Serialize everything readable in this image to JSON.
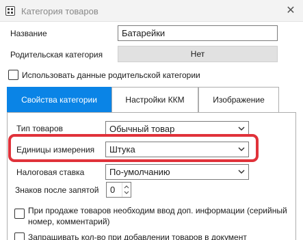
{
  "window": {
    "title": "Категория товаров",
    "close_glyph": "✕"
  },
  "form": {
    "name_label": "Название",
    "name_value": "Батарейки",
    "parent_label": "Родительская категория",
    "parent_value": "Нет",
    "use_parent_label": "Использовать данные родительской категории",
    "use_parent_checked": false
  },
  "tabs": [
    {
      "label": "Свойства категории",
      "active": true
    },
    {
      "label": "Настройки ККМ",
      "active": false
    },
    {
      "label": "Изображение",
      "active": false
    }
  ],
  "properties": {
    "goods_type_label": "Тип товаров",
    "goods_type_value": "Обычный товар",
    "units_label": "Единицы измерения",
    "units_value": "Штука",
    "tax_label": "Налоговая ставка",
    "tax_value": "По-умолчанию",
    "decimals_label": "Знаков после запятой",
    "decimals_value": "0",
    "extra_info_label_line1": "При продаже товаров необходим ввод доп. информации (серийный",
    "extra_info_label_line2": "номер, комментарий)",
    "ask_qty_label": "Запрашивать кол-во при добавлении товаров в документ"
  },
  "colors": {
    "accent": "#0a84e6",
    "highlight": "#e0323a"
  },
  "icons": {
    "app": "app-grid-icon",
    "close": "close-icon",
    "dropdown": "chevron-down-icon",
    "spinner": "spinner-arrows-icon"
  }
}
